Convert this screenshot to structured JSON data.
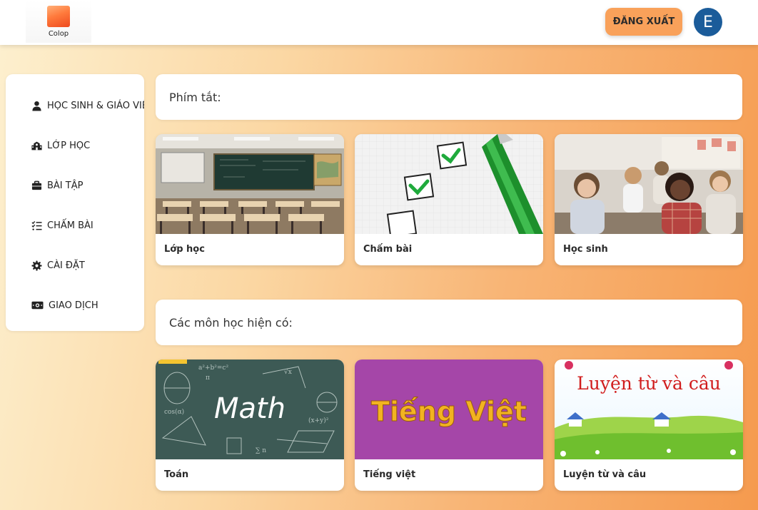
{
  "header": {
    "logo_text": "Colop",
    "logout_label": "ĐĂNG XUẤT",
    "avatar_letter": "E"
  },
  "sidebar": {
    "items": [
      {
        "label": "HỌC SINH & GIÁO VIÊN",
        "icon": "person-icon"
      },
      {
        "label": "LỚP HỌC",
        "icon": "school-icon"
      },
      {
        "label": "BÀI TẬP",
        "icon": "briefcase-icon"
      },
      {
        "label": "CHẤM BÀI",
        "icon": "checklist-icon"
      },
      {
        "label": "CÀI ĐẶT",
        "icon": "gear-icon"
      },
      {
        "label": "GIAO DỊCH",
        "icon": "money-icon"
      }
    ]
  },
  "shortcuts": {
    "title": "Phím tắt:",
    "cards": [
      {
        "label": "Lớp học",
        "image": "classroom-image"
      },
      {
        "label": "Chấm bài",
        "image": "checklist-pen-image"
      },
      {
        "label": "Học sinh",
        "image": "students-image"
      }
    ]
  },
  "subjects": {
    "title": "Các môn học hiện có:",
    "cards": [
      {
        "label": "Toán",
        "image": "math-chalkboard-image",
        "image_text": "Math"
      },
      {
        "label": "Tiếng việt",
        "image": "tieng-viet-banner-image",
        "image_text": "Tiếng Việt"
      },
      {
        "label": "Luyện từ và câu",
        "image": "luyen-tu-va-cau-banner-image",
        "image_text": "Luyện từ và câu"
      }
    ]
  },
  "colors": {
    "accent": "#f9a15a",
    "avatar_bg": "#1b5c9a"
  }
}
